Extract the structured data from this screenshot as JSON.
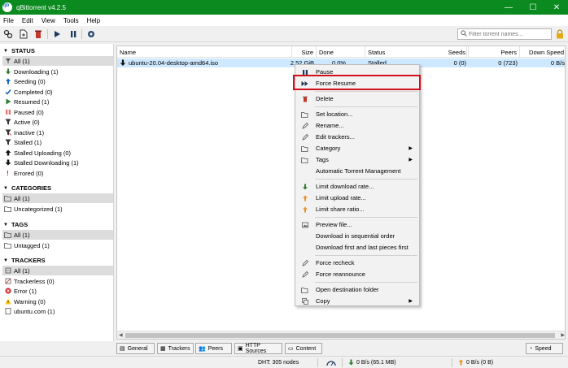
{
  "window": {
    "title": "qBittorrent v4.2.5"
  },
  "menu": [
    "File",
    "Edit",
    "View",
    "Tools",
    "Help"
  ],
  "toolbar": {
    "icons": [
      "add-link-icon",
      "add-file-icon",
      "delete-icon",
      "resume-icon",
      "pause-icon",
      "options-icon"
    ],
    "filter_placeholder": "Filter torrent names..."
  },
  "sidebar": {
    "status": {
      "title": "STATUS",
      "items": [
        {
          "label": "All (1)",
          "icon": "all-icon",
          "selected": true
        },
        {
          "label": "Downloading (1)",
          "icon": "downloading-icon"
        },
        {
          "label": "Seeding (0)",
          "icon": "seeding-icon"
        },
        {
          "label": "Completed (0)",
          "icon": "completed-icon"
        },
        {
          "label": "Resumed (1)",
          "icon": "resumed-icon"
        },
        {
          "label": "Paused (0)",
          "icon": "paused-icon"
        },
        {
          "label": "Active (0)",
          "icon": "active-icon"
        },
        {
          "label": "Inactive (1)",
          "icon": "inactive-icon"
        },
        {
          "label": "Stalled (1)",
          "icon": "stalled-icon"
        },
        {
          "label": "Stalled Uploading (0)",
          "icon": "stalled-upload-icon"
        },
        {
          "label": "Stalled Downloading (1)",
          "icon": "stalled-download-icon"
        },
        {
          "label": "Errored (0)",
          "icon": "errored-icon"
        }
      ]
    },
    "categories": {
      "title": "CATEGORIES",
      "items": [
        {
          "label": "All (1)",
          "icon": "folder-icon",
          "selected": true
        },
        {
          "label": "Uncategorized (1)",
          "icon": "folder-icon"
        }
      ]
    },
    "tags": {
      "title": "TAGS",
      "items": [
        {
          "label": "All (1)",
          "icon": "folder-icon",
          "selected": true
        },
        {
          "label": "Untagged (1)",
          "icon": "folder-icon"
        }
      ]
    },
    "trackers": {
      "title": "TRACKERS",
      "items": [
        {
          "label": "All (1)",
          "icon": "tracker-all-icon",
          "selected": true
        },
        {
          "label": "Trackerless (0)",
          "icon": "trackerless-icon"
        },
        {
          "label": "Error (1)",
          "icon": "error-icon"
        },
        {
          "label": "Warning (0)",
          "icon": "warning-icon"
        },
        {
          "label": "ubuntu.com (1)",
          "icon": "globe-icon"
        }
      ]
    }
  },
  "table": {
    "columns": [
      "Name",
      "Size",
      "Done",
      "Status",
      "Seeds",
      "Peers",
      "Down Speed"
    ],
    "rows": [
      {
        "name": "ubuntu-20.04-desktop-amd64.iso",
        "size": "2.52 GiB",
        "done": "0.0%",
        "status": "Stalled",
        "seeds": "0 (0)",
        "peers": "0 (723)",
        "down_speed": "0 B/s"
      }
    ]
  },
  "context_menu": {
    "items": [
      {
        "label": "Pause",
        "icon": "pause-icon"
      },
      {
        "label": "Force Resume",
        "icon": "force-resume-icon",
        "highlighted": true
      },
      {
        "label": "Delete",
        "icon": "delete-icon"
      },
      {
        "label": "Set location...",
        "icon": "folder-open-icon"
      },
      {
        "label": "Rename...",
        "icon": "rename-icon"
      },
      {
        "label": "Edit trackers...",
        "icon": "edit-trackers-icon"
      },
      {
        "label": "Category",
        "icon": "category-icon",
        "submenu": true
      },
      {
        "label": "Tags",
        "icon": "tags-icon",
        "submenu": true
      },
      {
        "label": "Automatic Torrent Management",
        "icon": ""
      },
      {
        "label": "Limit download rate...",
        "icon": "limit-download-icon"
      },
      {
        "label": "Limit upload rate...",
        "icon": "limit-upload-icon"
      },
      {
        "label": "Limit share ratio...",
        "icon": "limit-share-icon"
      },
      {
        "label": "Preview file...",
        "icon": "preview-icon"
      },
      {
        "label": "Download in sequential order",
        "icon": ""
      },
      {
        "label": "Download first and last pieces first",
        "icon": ""
      },
      {
        "label": "Force recheck",
        "icon": "recheck-icon"
      },
      {
        "label": "Force reannounce",
        "icon": "reannounce-icon"
      },
      {
        "label": "Open destination folder",
        "icon": "folder-open-icon"
      },
      {
        "label": "Copy",
        "icon": "copy-icon",
        "submenu": true
      }
    ]
  },
  "bottom_tabs": [
    {
      "label": "General",
      "icon": "general-icon"
    },
    {
      "label": "Trackers",
      "icon": "trackers-icon"
    },
    {
      "label": "Peers",
      "icon": "peers-icon"
    },
    {
      "label": "HTTP Sources",
      "icon": "http-sources-icon"
    },
    {
      "label": "Content",
      "icon": "content-icon"
    }
  ],
  "speed_button": "Speed",
  "statusbar": {
    "dht": "DHT: 305 nodes",
    "download": "0 B/s (65.1 MB)",
    "upload": "0 B/s (0 B)"
  },
  "colors": {
    "titlebar": "#0b8a1f",
    "selection": "#cde8ff",
    "highlight_box": "#d0101b"
  }
}
